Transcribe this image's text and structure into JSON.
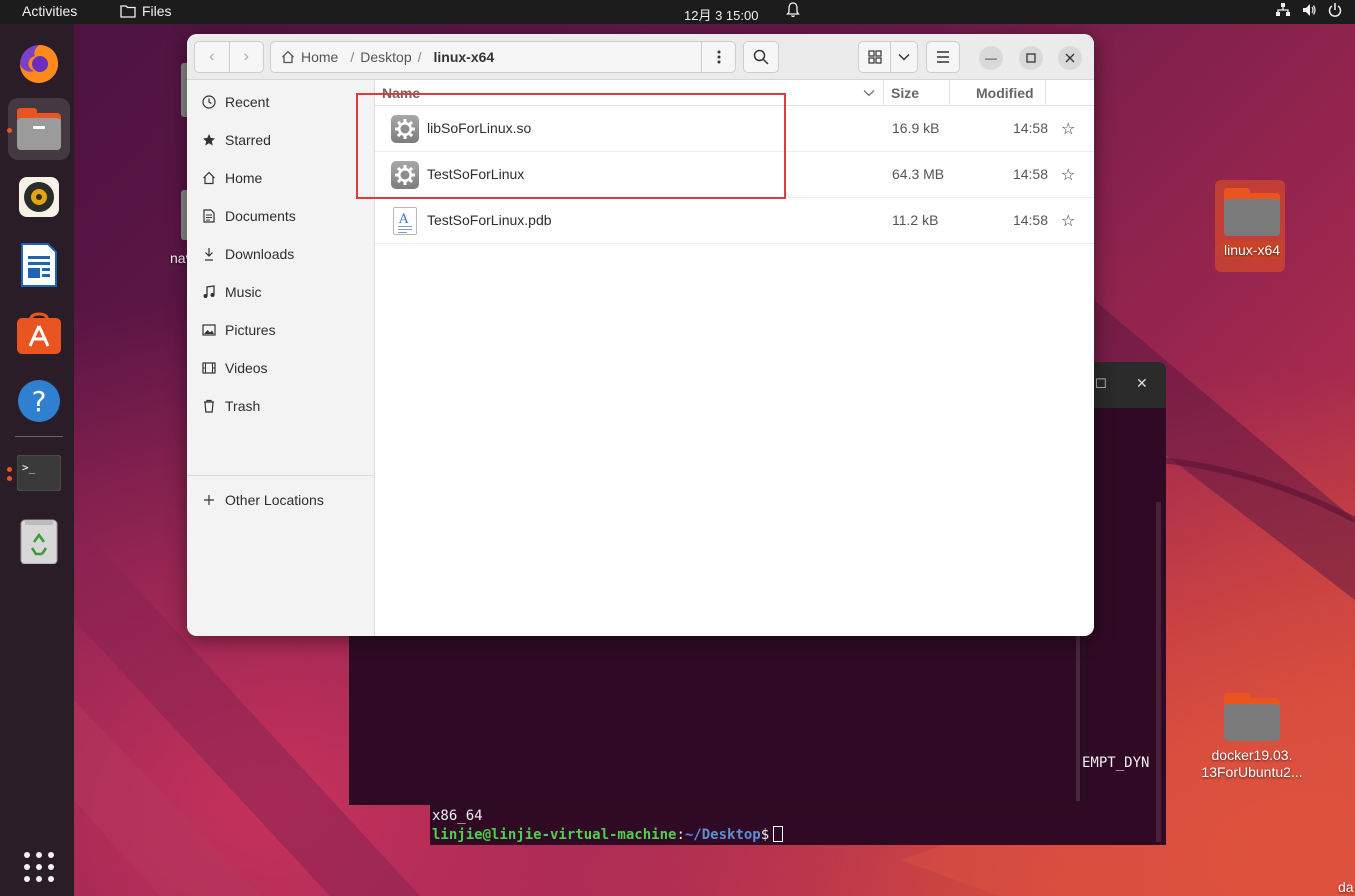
{
  "topbar": {
    "activities": "Activities",
    "app_name": "Files",
    "clock": "12月 3  15:00"
  },
  "dock": {
    "items": [
      "firefox-icon",
      "files-icon",
      "rhythmbox-icon",
      "libreoffice-writer-icon",
      "app-center-icon",
      "help-icon",
      "terminal-icon",
      "trash-icon",
      "show-apps-icon"
    ]
  },
  "desktop": {
    "icons": [
      {
        "label": "linux-x64",
        "selected": true
      },
      {
        "label": "docker19.03.\n13ForUbuntu2..."
      },
      {
        "label": "nav"
      },
      {
        "label": "da"
      }
    ]
  },
  "terminal": {
    "partial_text": "EMPT_DYN",
    "arch_line": "x86_64",
    "prompt_user": "linjie@linjie-virtual-machine",
    "prompt_colon": ":",
    "prompt_path": "~/Desktop",
    "prompt_symbol": "$"
  },
  "files_window": {
    "breadcrumbs": [
      "Home",
      "Desktop",
      "linux-x64"
    ],
    "sidebar": [
      {
        "label": "Recent",
        "icon": "clock-icon"
      },
      {
        "label": "Starred",
        "icon": "star-icon"
      },
      {
        "label": "Home",
        "icon": "home-icon"
      },
      {
        "label": "Documents",
        "icon": "document-icon"
      },
      {
        "label": "Downloads",
        "icon": "download-icon"
      },
      {
        "label": "Music",
        "icon": "music-icon"
      },
      {
        "label": "Pictures",
        "icon": "picture-icon"
      },
      {
        "label": "Videos",
        "icon": "video-icon"
      },
      {
        "label": "Trash",
        "icon": "trash-icon"
      }
    ],
    "other_locations": "Other Locations",
    "columns": {
      "name": "Name",
      "size": "Size",
      "modified": "Modified"
    },
    "files": [
      {
        "name": "libSoForLinux.so",
        "size": "16.9 kB",
        "modified": "14:58",
        "type": "binary"
      },
      {
        "name": "TestSoForLinux",
        "size": "64.3 MB",
        "modified": "14:58",
        "type": "binary"
      },
      {
        "name": "TestSoForLinux.pdb",
        "size": "11.2 kB",
        "modified": "14:58",
        "type": "document"
      }
    ]
  },
  "colors": {
    "accent": "#e95420",
    "highlight_box": "#e03c3c",
    "terminal_bg": "#300a24"
  }
}
